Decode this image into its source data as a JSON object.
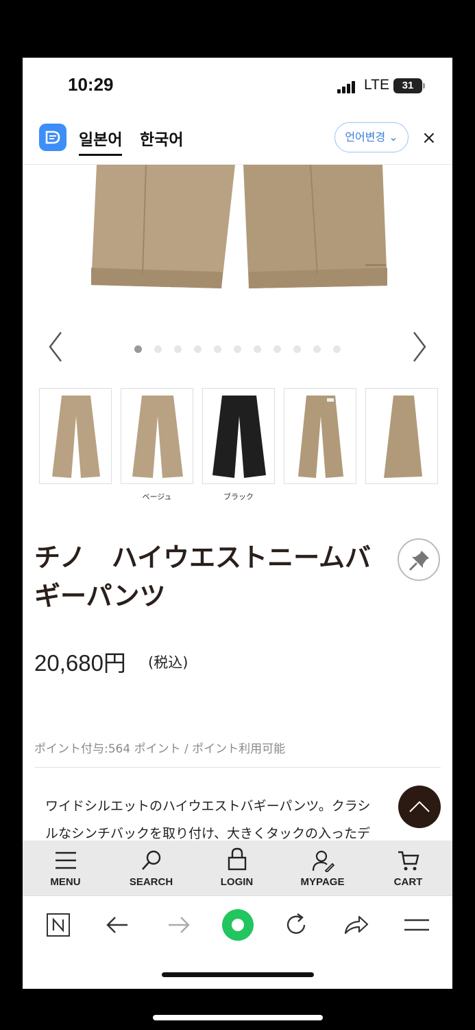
{
  "status": {
    "time": "10:29",
    "network": "LTE",
    "battery": "31"
  },
  "translate_bar": {
    "tab_active": "일본어",
    "tab_other": "한국어",
    "change_language": "언어변경 ⌄",
    "close": "×"
  },
  "gallery": {
    "dot_count": 11,
    "active_dot": 0
  },
  "thumbnails": [
    {
      "color": "beige",
      "caption": ""
    },
    {
      "color": "beige",
      "caption": "ベージュ"
    },
    {
      "color": "black",
      "caption": "ブラック"
    },
    {
      "color": "beige",
      "caption": ""
    },
    {
      "color": "beige",
      "caption": ""
    }
  ],
  "product": {
    "title_line1": "チノ　ハイウエストニームバ",
    "title_line2": "ギーパンツ",
    "price": "20,680円",
    "tax": "(税込)",
    "points": "ポイント付与:564 ポイント / ポイント利用可能",
    "description_line1": "ワイドシルエットのハイウエストバギーパンツ。クラシ",
    "description_line2": "ルなシンチバックを取り付け、大きくタックの入ったデ"
  },
  "bottom_nav": [
    {
      "label": "MENU",
      "icon": "menu-icon"
    },
    {
      "label": "SEARCH",
      "icon": "search-icon"
    },
    {
      "label": "LOGIN",
      "icon": "lock-icon"
    },
    {
      "label": "MYPAGE",
      "icon": "user-icon"
    },
    {
      "label": "CART",
      "icon": "cart-icon"
    }
  ],
  "colors": {
    "beige": "#b8a283",
    "black": "#1f1f1f",
    "accent_blue": "#3d8ef7",
    "brown": "#2b1a12",
    "green": "#22c55e"
  }
}
